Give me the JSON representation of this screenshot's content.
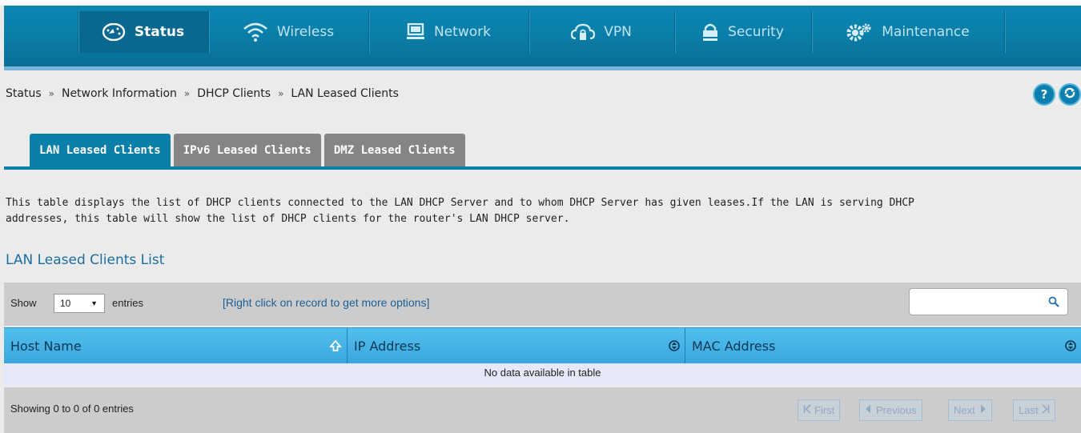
{
  "nav": {
    "items": [
      {
        "label": "Status",
        "icon": "dashboard-gauge-icon",
        "active": true
      },
      {
        "label": "Wireless",
        "icon": "wifi-icon"
      },
      {
        "label": "Network",
        "icon": "monitor-icon"
      },
      {
        "label": "VPN",
        "icon": "cloud-lock-icon"
      },
      {
        "label": "Security",
        "icon": "padlock-icon"
      },
      {
        "label": "Maintenance",
        "icon": "gears-icon"
      }
    ]
  },
  "breadcrumb": [
    "Status",
    "Network Information",
    "DHCP Clients",
    "LAN Leased Clients"
  ],
  "breadcrumb_separator": "»",
  "help_button": "?",
  "tabs": [
    {
      "label": "LAN Leased Clients",
      "active": true
    },
    {
      "label": "IPv6 Leased Clients"
    },
    {
      "label": "DMZ Leased Clients"
    }
  ],
  "description": {
    "line1": "This table displays the list of DHCP clients connected to the LAN DHCP Server and to whom DHCP Server has given leases.If the LAN is serving DHCP",
    "line2": "addresses, this table will show the list of DHCP clients for the router's LAN DHCP server."
  },
  "section_title": "LAN Leased Clients List",
  "toolbar": {
    "show_label": "Show",
    "entries_value": "10",
    "entries_label": "entries",
    "hint": "[Right click on record to get more options]",
    "search_value": ""
  },
  "table": {
    "columns": [
      "Host Name",
      "IP Address",
      "MAC Address"
    ],
    "empty_message": "No data available in table"
  },
  "footer": {
    "showing": "Showing 0 to 0 of 0 entries",
    "first": "First",
    "previous": "Previous",
    "next": "Next",
    "last": "Last"
  },
  "colors": {
    "nav_blue": "#0a7fa9",
    "table_header_blue": "#3aa6dd",
    "tab_inactive": "#858585",
    "link_blue": "#1b5f96"
  }
}
